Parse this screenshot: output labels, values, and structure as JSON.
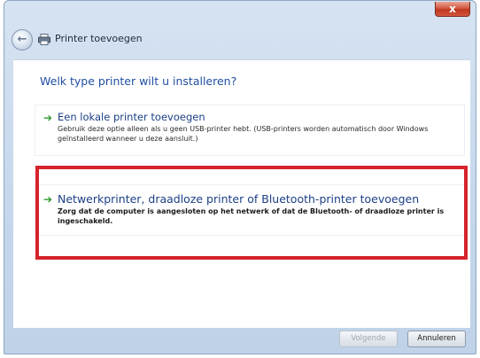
{
  "window": {
    "title": "Printer toevoegen",
    "close_label": "x"
  },
  "nav": {
    "back_label": "←"
  },
  "main": {
    "heading": "Welk type printer wilt u installeren?",
    "options": [
      {
        "title": "Een lokale printer toevoegen",
        "description": "Gebruik deze optie alleen als u geen USB-printer hebt. (USB-printers worden automatisch door Windows geïnstalleerd wanneer u deze aansluit.)"
      },
      {
        "title": "Netwerkprinter, draadloze printer of Bluetooth-printer toevoegen",
        "description": "Zorg dat de computer is aangesloten op het netwerk of dat de Bluetooth- of draadloze printer is ingeschakeld."
      }
    ],
    "option_arrow": "➔"
  },
  "footer": {
    "next_label": "Volgende",
    "cancel_label": "Annuleren"
  },
  "colors": {
    "highlight": "#d6232c",
    "heading": "#1f4ea1",
    "arrow": "#2f9b2f"
  }
}
